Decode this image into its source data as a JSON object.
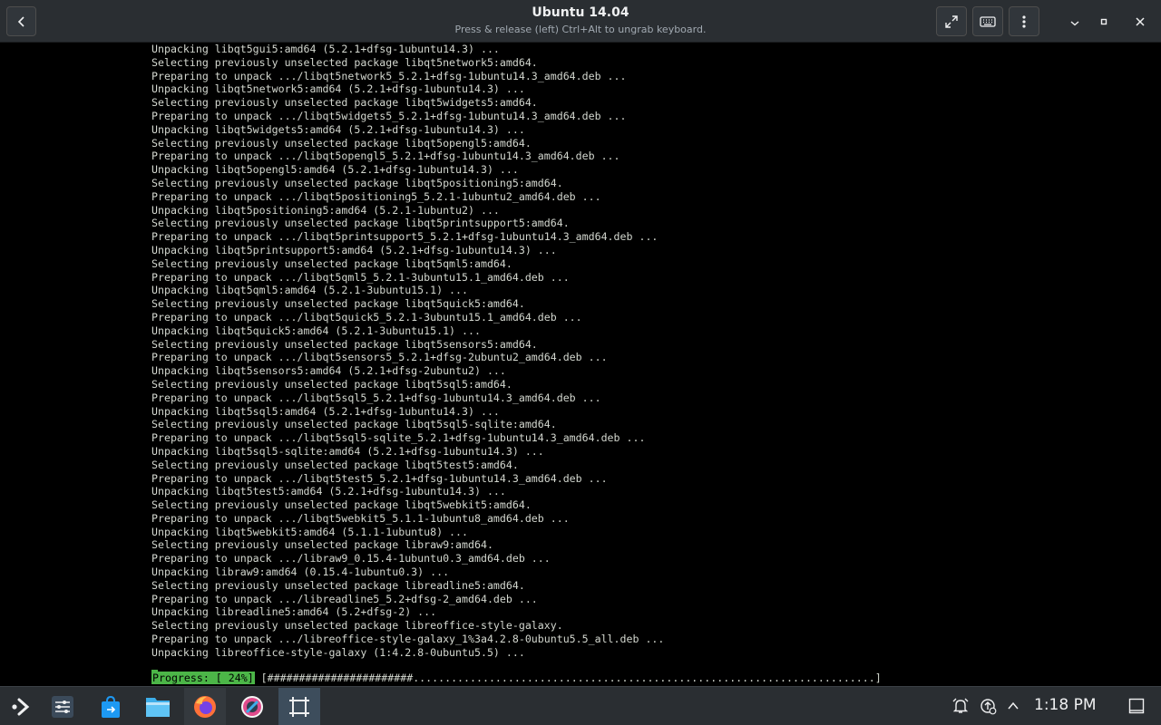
{
  "window": {
    "title": "Ubuntu 14.04",
    "subtitle": "Press & release (left) Ctrl+Alt to ungrab keyboard."
  },
  "terminal": {
    "lines": [
      "Unpacking libqt5gui5:amd64 (5.2.1+dfsg-1ubuntu14.3) ...",
      "Selecting previously unselected package libqt5network5:amd64.",
      "Preparing to unpack .../libqt5network5_5.2.1+dfsg-1ubuntu14.3_amd64.deb ...",
      "Unpacking libqt5network5:amd64 (5.2.1+dfsg-1ubuntu14.3) ...",
      "Selecting previously unselected package libqt5widgets5:amd64.",
      "Preparing to unpack .../libqt5widgets5_5.2.1+dfsg-1ubuntu14.3_amd64.deb ...",
      "Unpacking libqt5widgets5:amd64 (5.2.1+dfsg-1ubuntu14.3) ...",
      "Selecting previously unselected package libqt5opengl5:amd64.",
      "Preparing to unpack .../libqt5opengl5_5.2.1+dfsg-1ubuntu14.3_amd64.deb ...",
      "Unpacking libqt5opengl5:amd64 (5.2.1+dfsg-1ubuntu14.3) ...",
      "Selecting previously unselected package libqt5positioning5:amd64.",
      "Preparing to unpack .../libqt5positioning5_5.2.1-1ubuntu2_amd64.deb ...",
      "Unpacking libqt5positioning5:amd64 (5.2.1-1ubuntu2) ...",
      "Selecting previously unselected package libqt5printsupport5:amd64.",
      "Preparing to unpack .../libqt5printsupport5_5.2.1+dfsg-1ubuntu14.3_amd64.deb ...",
      "Unpacking libqt5printsupport5:amd64 (5.2.1+dfsg-1ubuntu14.3) ...",
      "Selecting previously unselected package libqt5qml5:amd64.",
      "Preparing to unpack .../libqt5qml5_5.2.1-3ubuntu15.1_amd64.deb ...",
      "Unpacking libqt5qml5:amd64 (5.2.1-3ubuntu15.1) ...",
      "Selecting previously unselected package libqt5quick5:amd64.",
      "Preparing to unpack .../libqt5quick5_5.2.1-3ubuntu15.1_amd64.deb ...",
      "Unpacking libqt5quick5:amd64 (5.2.1-3ubuntu15.1) ...",
      "Selecting previously unselected package libqt5sensors5:amd64.",
      "Preparing to unpack .../libqt5sensors5_5.2.1+dfsg-2ubuntu2_amd64.deb ...",
      "Unpacking libqt5sensors5:amd64 (5.2.1+dfsg-2ubuntu2) ...",
      "Selecting previously unselected package libqt5sql5:amd64.",
      "Preparing to unpack .../libqt5sql5_5.2.1+dfsg-1ubuntu14.3_amd64.deb ...",
      "Unpacking libqt5sql5:amd64 (5.2.1+dfsg-1ubuntu14.3) ...",
      "Selecting previously unselected package libqt5sql5-sqlite:amd64.",
      "Preparing to unpack .../libqt5sql5-sqlite_5.2.1+dfsg-1ubuntu14.3_amd64.deb ...",
      "Unpacking libqt5sql5-sqlite:amd64 (5.2.1+dfsg-1ubuntu14.3) ...",
      "Selecting previously unselected package libqt5test5:amd64.",
      "Preparing to unpack .../libqt5test5_5.2.1+dfsg-1ubuntu14.3_amd64.deb ...",
      "Unpacking libqt5test5:amd64 (5.2.1+dfsg-1ubuntu14.3) ...",
      "Selecting previously unselected package libqt5webkit5:amd64.",
      "Preparing to unpack .../libqt5webkit5_5.1.1-1ubuntu8_amd64.deb ...",
      "Unpacking libqt5webkit5:amd64 (5.1.1-1ubuntu8) ...",
      "Selecting previously unselected package libraw9:amd64.",
      "Preparing to unpack .../libraw9_0.15.4-1ubuntu0.3_amd64.deb ...",
      "Unpacking libraw9:amd64 (0.15.4-1ubuntu0.3) ...",
      "Selecting previously unselected package libreadline5:amd64.",
      "Preparing to unpack .../libreadline5_5.2+dfsg-2_amd64.deb ...",
      "Unpacking libreadline5:amd64 (5.2+dfsg-2) ...",
      "Selecting previously unselected package libreoffice-style-galaxy.",
      "Preparing to unpack .../libreoffice-style-galaxy_1%3a4.2.8-0ubuntu5.5_all.deb ...",
      "Unpacking libreoffice-style-galaxy (1:4.2.8-0ubuntu5.5) ..."
    ],
    "progress_label": "Progress: [ 24%]",
    "progress_bar": " [#######################.........................................................................]",
    "progress_percent": 24
  },
  "taskbar": {
    "apps": [
      {
        "name": "application-launcher-icon"
      },
      {
        "name": "mixer-settings-icon"
      },
      {
        "name": "discover-store-icon"
      },
      {
        "name": "file-manager-icon"
      },
      {
        "name": "firefox-icon"
      },
      {
        "name": "spectacle-icon"
      },
      {
        "name": "virtual-machine-icon"
      }
    ],
    "clock": "1:18 PM"
  },
  "colors": {
    "progress_green": "#4cb648",
    "panel": "#2a2e32",
    "terminal_text": "#d3d7cf"
  }
}
